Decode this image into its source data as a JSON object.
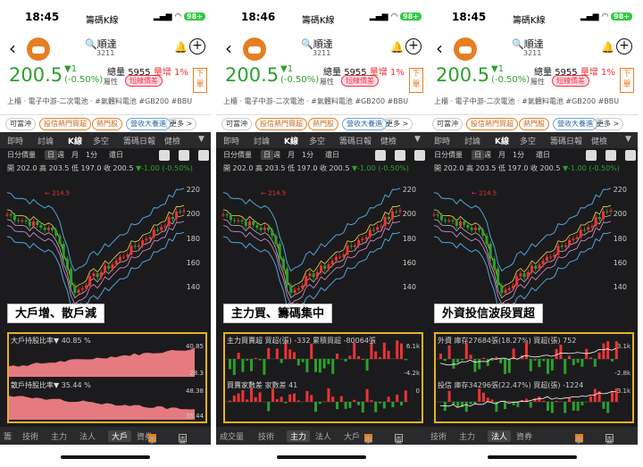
{
  "status": {
    "times": [
      "18:45",
      "18:46",
      "18:45"
    ],
    "app": "籌碼K線",
    "battery": "98+"
  },
  "stock": {
    "name": "順達",
    "code": "3211",
    "price": "200.5",
    "change_abs": "▼1",
    "change_pct": "(-0.50%)",
    "volume_label": "總量",
    "volume": "5955",
    "qty_label": "量增",
    "qty_change": "1%",
    "tag_attr": "屬性",
    "tag_bond": "短線價差",
    "order": "下單",
    "industry": "上櫃 · 電子中游-二次電池 · #氣體料電池 #GB200 #BBU"
  },
  "chips": [
    "可當沖",
    "投信熱門買超",
    "熱門股",
    "營收大養進",
    "更多 >"
  ],
  "tabs": [
    "即時",
    "討論",
    "K線",
    "多空",
    "籌碼日報",
    "健檢"
  ],
  "active_tab": "K線",
  "tools": [
    "日分價量",
    "日",
    "週",
    "月",
    "1分",
    "還日"
  ],
  "ohlc": {
    "text": "開 202.0 高 203.5 低 197.0 收 200.5",
    "chg": "▼-1.00 (-0.50%)"
  },
  "chart_data": [
    {
      "type": "candlestick",
      "ylim": [
        130,
        225
      ],
      "yticks": [
        "220",
        "200",
        "180",
        "160",
        "140"
      ],
      "annotation_high": "214.5",
      "annotation_low": "129.5"
    }
  ],
  "panels": [
    {
      "caption": "大戶增、散戶減",
      "ind1_title": "大戶持股比率▼",
      "ind1_value": "40.85 %",
      "ind1_axis_top": "40.85",
      "ind1_axis_bot": "28.3",
      "ind2_title": "散戶持股比率▼",
      "ind2_value": "35.44 %",
      "ind2_axis_top": "48.38",
      "ind2_axis_bot": "35.44",
      "bottom": [
        "籌",
        "技術",
        "主力",
        "法人",
        "大戶",
        "資券"
      ],
      "bottom_active": "大戶",
      "chk1": "事件",
      "chk2": "查價線"
    },
    {
      "caption": "主力買、籌碼集中",
      "ind1_title": "主力買賣超",
      "ind1_value": "買超(張) -332  累積買超 -80064張",
      "ind1_axis_top": "6.1k",
      "ind1_axis_bot": "-4.2k",
      "ind2_title": "買賣家數差",
      "ind2_value": "家數差 41",
      "ind2_axis_top": "0",
      "ind2_axis_bot": "",
      "bottom": [
        "成交量",
        "技術",
        "主力",
        "法人",
        "大戶"
      ],
      "bottom_active": "主力",
      "chk1": "事件",
      "chk2": "查價線"
    },
    {
      "caption": "外資投信波段買超",
      "ind1_title": "外資",
      "ind1_value": "庫存27684張(18.27%)  買超(張) 752",
      "ind1_axis_top": "3.1k",
      "ind1_axis_bot": "-2.8k",
      "ind2_title": "投信",
      "ind2_value": "庫存34296張(22.47%)  買超(張) -1224",
      "ind2_axis_top": "3.1k",
      "ind2_axis_bot": "",
      "bottom": [
        "技術",
        "主力",
        "法人",
        "資券"
      ],
      "bottom_active": "法人",
      "chk1": "事件",
      "chk2": "查價線"
    }
  ]
}
